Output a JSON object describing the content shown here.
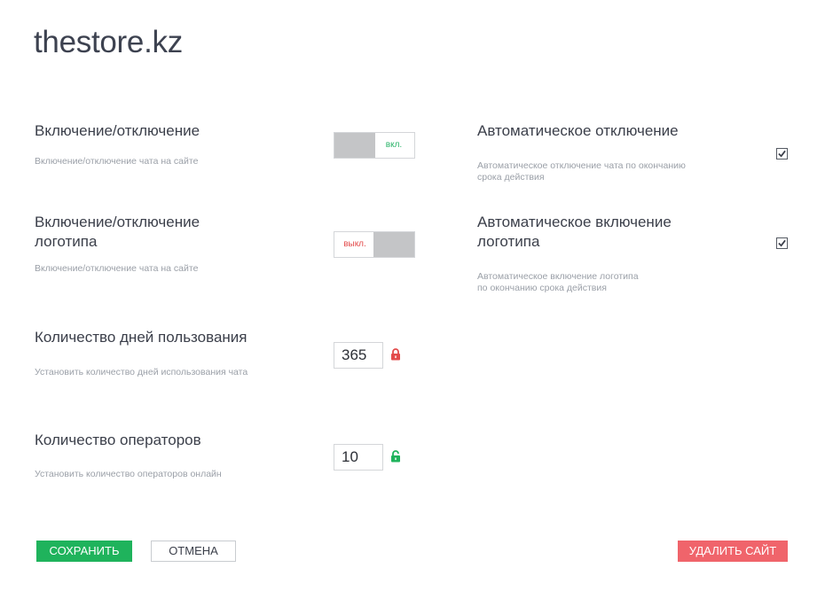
{
  "site": {
    "title": "thestore.kz"
  },
  "settings": {
    "chat_toggle": {
      "title": "Включение/отключение",
      "description": "Включение/отключение чата на сайте",
      "state_label": "вкл.",
      "state": "on"
    },
    "logo_toggle": {
      "title_line1": "Включение/отключение",
      "title_line2": "логотипа",
      "description": "Включение/отключение чата на сайте",
      "state_label": "выкл.",
      "state": "off"
    },
    "auto_disable": {
      "title": "Автоматическое отключение",
      "description_line1": "Автоматическое отключение чата по окончанию",
      "description_line2": "срока действия",
      "checked": true
    },
    "auto_logo": {
      "title_line1": "Автоматическое включение",
      "title_line2": "логотипа",
      "description_line1": "Автоматическое включение логотипа",
      "description_line2": "по окончанию срока действия",
      "checked": true
    },
    "days": {
      "title": "Количество дней пользования",
      "description": "Установить количество дней использования чата",
      "value": "365",
      "locked": true,
      "lock_color": "#e34b4b"
    },
    "operators": {
      "title": "Количество операторов",
      "description": "Установить количество операторов онлайн",
      "value": "10",
      "locked": false,
      "lock_color": "#1fb35c"
    }
  },
  "actions": {
    "save_label": "СОХРАНИТЬ",
    "cancel_label": "ОТМЕНА",
    "delete_label": "УДАЛИТЬ САЙТ"
  },
  "colors": {
    "save": "#1fb35c",
    "delete": "#f0646b",
    "on_text": "#2db46a",
    "off_text": "#e34b4b"
  }
}
